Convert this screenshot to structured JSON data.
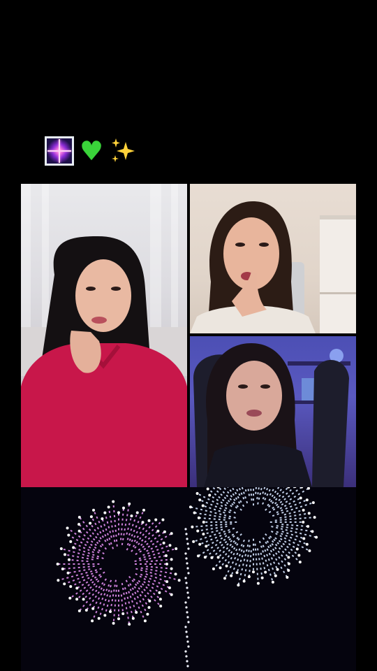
{
  "caption": {
    "emojis": [
      "firework-icon",
      "green-heart-icon",
      "sparkles-icon"
    ],
    "colors": {
      "heart": "#3ad43a",
      "sparkle": "#ffd23a",
      "firework_frame": "#e8eef5"
    }
  },
  "video_grid": {
    "participants": [
      {
        "position": "left",
        "top_color": "#e9e9ec",
        "shirt_color": "#c8174a"
      },
      {
        "position": "top-right",
        "top_color": "#e8ddd3",
        "shirt_color": "#ece6df"
      },
      {
        "position": "bottom-right",
        "top_color": "#4c4fb4",
        "shirt_color": "#161622"
      }
    ]
  },
  "effect": {
    "name": "fireworks",
    "colors": {
      "burst_left": "#e28ef0",
      "burst_right": "#d6e6ff",
      "background": "#05040e"
    }
  }
}
